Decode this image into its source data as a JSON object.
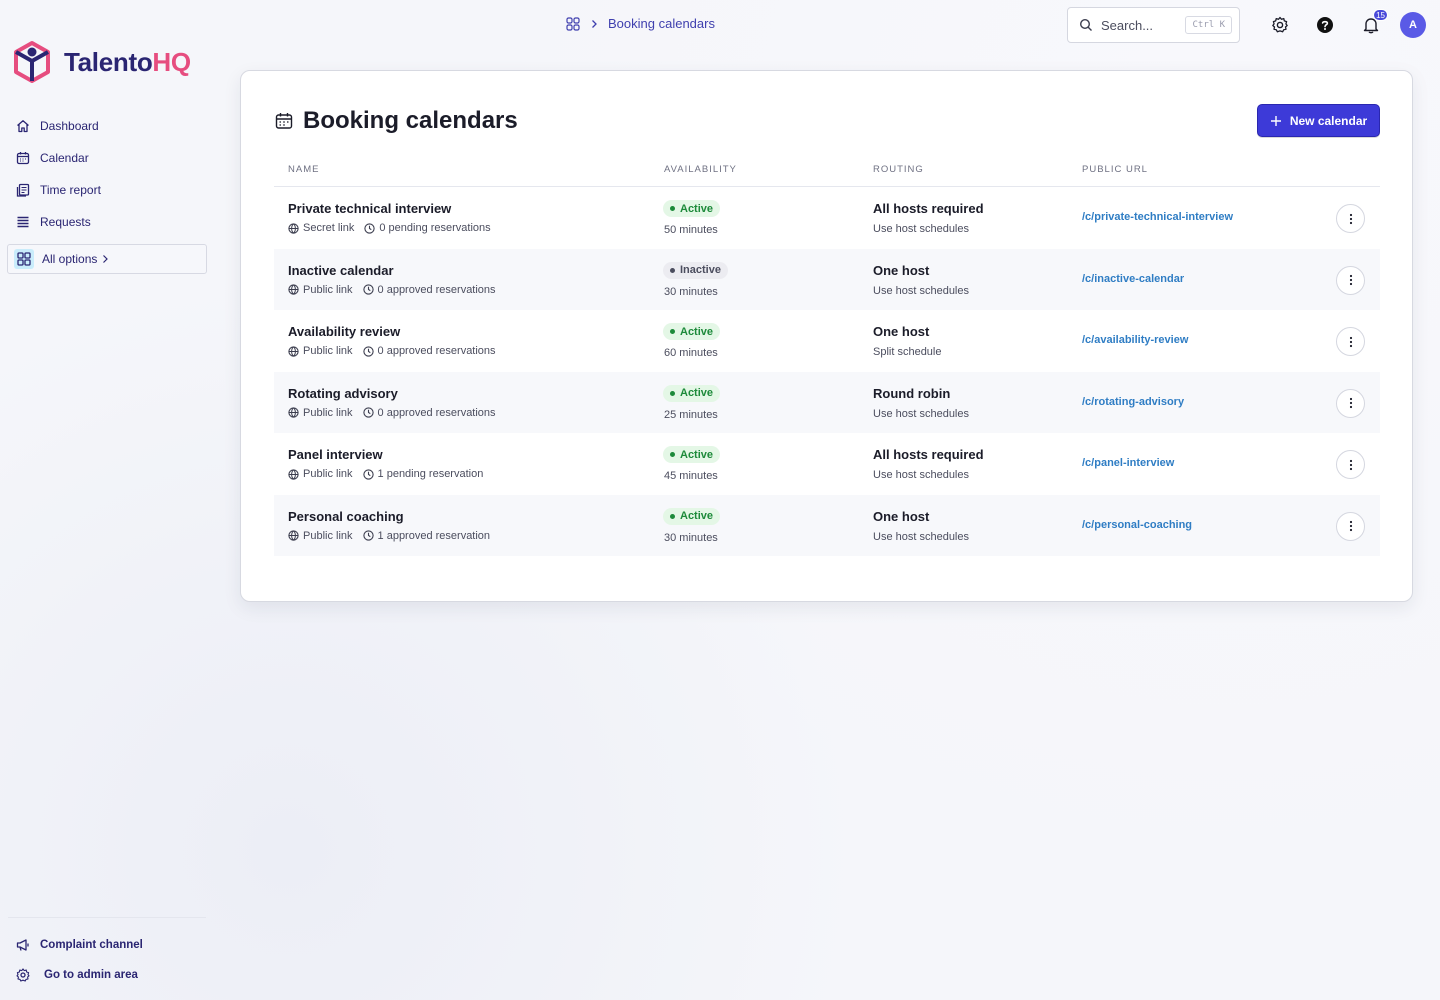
{
  "brand": {
    "name_part1": "Talento",
    "name_part2": "HQ",
    "colors": {
      "primary": "#2a2572",
      "accent": "#e64d7f"
    }
  },
  "sidebar": {
    "items": [
      {
        "label": "Dashboard",
        "icon": "home-icon"
      },
      {
        "label": "Calendar",
        "icon": "calendar-icon"
      },
      {
        "label": "Time report",
        "icon": "report-icon"
      },
      {
        "label": "Requests",
        "icon": "list-icon"
      }
    ],
    "all_options": "All options",
    "bottom": [
      {
        "label": "Complaint channel",
        "icon": "megaphone-icon"
      },
      {
        "label": "Go to admin area",
        "icon": "gear-icon"
      }
    ]
  },
  "topbar": {
    "breadcrumb": "Booking calendars",
    "search_placeholder": "Search...",
    "search_shortcut": "Ctrl K",
    "notifications_count": "15",
    "avatar_initial": "A"
  },
  "page": {
    "title": "Booking calendars",
    "new_button": "New calendar",
    "columns": [
      "NAME",
      "AVAILABILITY",
      "ROUTING",
      "PUBLIC URL"
    ],
    "rows": [
      {
        "name": "Private technical interview",
        "link_type": "Secret link",
        "reservations": "0 pending reservations",
        "status": "Active",
        "status_kind": "active",
        "duration": "50 minutes",
        "routing": "All hosts required",
        "routing_sub": "Use host schedules",
        "url": "/c/private-technical-interview"
      },
      {
        "name": "Inactive calendar",
        "link_type": "Public link",
        "reservations": "0 approved reservations",
        "status": "Inactive",
        "status_kind": "inactive",
        "duration": "30 minutes",
        "routing": "One host",
        "routing_sub": "Use host schedules",
        "url": "/c/inactive-calendar"
      },
      {
        "name": "Availability review",
        "link_type": "Public link",
        "reservations": "0 approved reservations",
        "status": "Active",
        "status_kind": "active",
        "duration": "60 minutes",
        "routing": "One host",
        "routing_sub": "Split schedule",
        "url": "/c/availability-review"
      },
      {
        "name": "Rotating advisory",
        "link_type": "Public link",
        "reservations": "0 approved reservations",
        "status": "Active",
        "status_kind": "active",
        "duration": "25 minutes",
        "routing": "Round robin",
        "routing_sub": "Use host schedules",
        "url": "/c/rotating-advisory"
      },
      {
        "name": "Panel interview",
        "link_type": "Public link",
        "reservations": "1 pending reservation",
        "status": "Active",
        "status_kind": "active",
        "duration": "45 minutes",
        "routing": "All hosts required",
        "routing_sub": "Use host schedules",
        "url": "/c/panel-interview"
      },
      {
        "name": "Personal coaching",
        "link_type": "Public link",
        "reservations": "1 approved reservation",
        "status": "Active",
        "status_kind": "active",
        "duration": "30 minutes",
        "routing": "One host",
        "routing_sub": "Use host schedules",
        "url": "/c/personal-coaching"
      }
    ]
  }
}
